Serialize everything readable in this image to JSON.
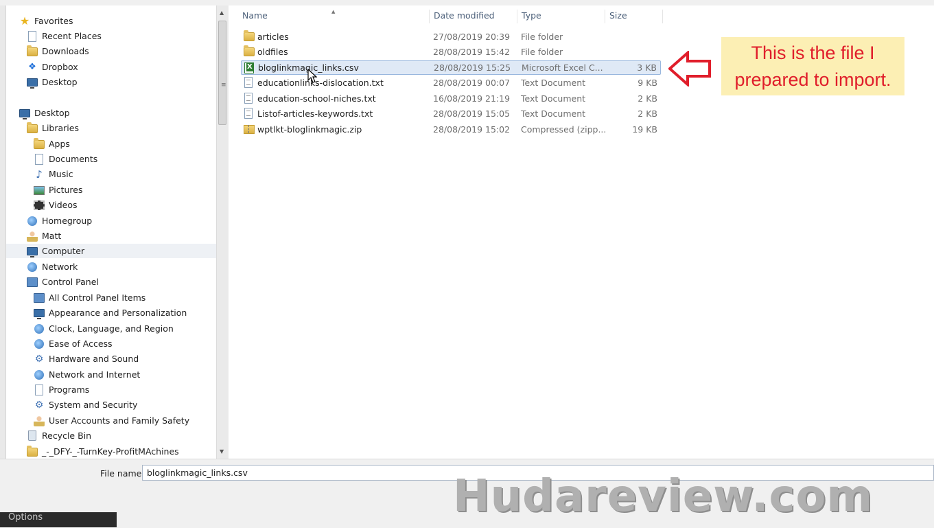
{
  "nav": {
    "items": [
      {
        "label": "Favorites",
        "icon": "star-icon"
      },
      {
        "label": "Recent Places",
        "icon": "recent-places-icon"
      },
      {
        "label": "Downloads",
        "icon": "downloads-folder-icon"
      },
      {
        "label": "Dropbox",
        "icon": "dropbox-icon"
      },
      {
        "label": "Desktop",
        "icon": "desktop-icon"
      },
      {
        "label": "Desktop",
        "icon": "desktop-icon"
      },
      {
        "label": "Libraries",
        "icon": "libraries-icon"
      },
      {
        "label": "Apps",
        "icon": "folder-icon"
      },
      {
        "label": "Documents",
        "icon": "documents-icon"
      },
      {
        "label": "Music",
        "icon": "music-icon"
      },
      {
        "label": "Pictures",
        "icon": "pictures-icon"
      },
      {
        "label": "Videos",
        "icon": "videos-icon"
      },
      {
        "label": "Homegroup",
        "icon": "homegroup-icon"
      },
      {
        "label": "Matt",
        "icon": "user-folder-icon"
      },
      {
        "label": "Computer",
        "icon": "computer-icon"
      },
      {
        "label": "Network",
        "icon": "network-icon"
      },
      {
        "label": "Control Panel",
        "icon": "control-panel-icon"
      },
      {
        "label": "All Control Panel Items",
        "icon": "control-panel-items-icon"
      },
      {
        "label": "Appearance and Personalization",
        "icon": "appearance-icon"
      },
      {
        "label": "Clock, Language, and Region",
        "icon": "clock-language-icon"
      },
      {
        "label": "Ease of Access",
        "icon": "ease-of-access-icon"
      },
      {
        "label": "Hardware and Sound",
        "icon": "hardware-sound-icon"
      },
      {
        "label": "Network and Internet",
        "icon": "network-internet-icon"
      },
      {
        "label": "Programs",
        "icon": "programs-icon"
      },
      {
        "label": "System and Security",
        "icon": "system-security-icon"
      },
      {
        "label": "User Accounts and Family Safety",
        "icon": "user-accounts-icon"
      },
      {
        "label": "Recycle Bin",
        "icon": "recycle-bin-icon"
      },
      {
        "label": "_-_DFY-_-TurnKey-ProfitMAchines",
        "icon": "folder-icon"
      }
    ]
  },
  "columns": {
    "name": "Name",
    "date": "Date modified",
    "type": "Type",
    "size": "Size"
  },
  "files": [
    {
      "name": "articles",
      "date": "27/08/2019 20:39",
      "type": "File folder",
      "size": ""
    },
    {
      "name": "oldfiles",
      "date": "28/08/2019 15:42",
      "type": "File folder",
      "size": ""
    },
    {
      "name": "bloglinkmagic_links.csv",
      "date": "28/08/2019 15:25",
      "type": "Microsoft Excel C...",
      "size": "3 KB"
    },
    {
      "name": "educationlinks-dislocation.txt",
      "date": "28/08/2019 00:07",
      "type": "Text Document",
      "size": "9 KB"
    },
    {
      "name": "education-school-niches.txt",
      "date": "16/08/2019 21:19",
      "type": "Text Document",
      "size": "2 KB"
    },
    {
      "name": "Listof-articles-keywords.txt",
      "date": "28/08/2019 15:05",
      "type": "Text Document",
      "size": "2 KB"
    },
    {
      "name": "wptlkt-bloglinkmagic.zip",
      "date": "28/08/2019 15:02",
      "type": "Compressed (zipp...",
      "size": "19 KB"
    }
  ],
  "annotation": {
    "line1": "This is the file I",
    "line2": "prepared to import.",
    "color": "#e01e2b",
    "background": "#fcefb4"
  },
  "bottom": {
    "file_name_label": "File name:",
    "file_name_value": "bloglinkmagic_links.csv",
    "options_label": "Options"
  },
  "watermark": "Hudareview.com"
}
